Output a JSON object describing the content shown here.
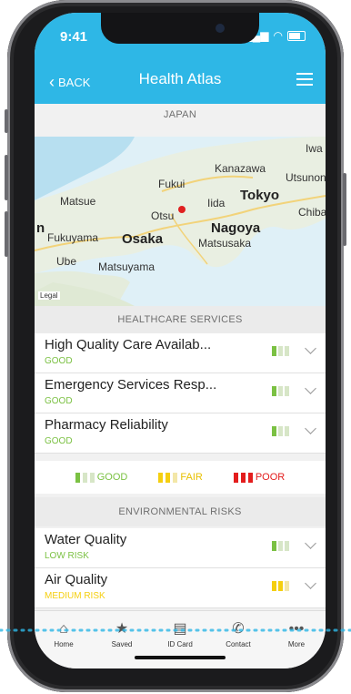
{
  "status": {
    "time": "9:41"
  },
  "nav": {
    "back": "BACK",
    "title": "Health Atlas"
  },
  "country": "JAPAN",
  "map": {
    "cities": [
      "Iwa",
      "Kanazawa",
      "Utsunon",
      "Fukui",
      "Tokyo",
      "Matsue",
      "Iida",
      "Chiba",
      "Otsu",
      "Nagoya",
      "n",
      "Fukuyama",
      "Osaka",
      "Matsusaka",
      "Ube",
      "Matsuyama"
    ],
    "legal": "Legal"
  },
  "healthcare": {
    "heading": "HEALTHCARE SERVICES",
    "rows": [
      {
        "name": "High Quality Care Availab...",
        "status": "GOOD"
      },
      {
        "name": "Emergency Services Resp...",
        "status": "GOOD"
      },
      {
        "name": "Pharmacy Reliability",
        "status": "GOOD"
      }
    ]
  },
  "legend": {
    "good": "GOOD",
    "fair": "FAIR",
    "poor": "POOR"
  },
  "environment": {
    "heading": "ENVIRONMENTAL RISKS",
    "rows": [
      {
        "name": "Water Quality",
        "status": "LOW RISK"
      },
      {
        "name": "Air Quality",
        "status": "MEDIUM RISK"
      }
    ]
  },
  "tabs": [
    "Home",
    "Saved",
    "ID Card",
    "Contact",
    "More"
  ],
  "colors": {
    "header": "#2eb7e6",
    "good": "#7bc143",
    "fair": "#f5cf10",
    "poor": "#e31d1d",
    "pin": "#e02020"
  }
}
